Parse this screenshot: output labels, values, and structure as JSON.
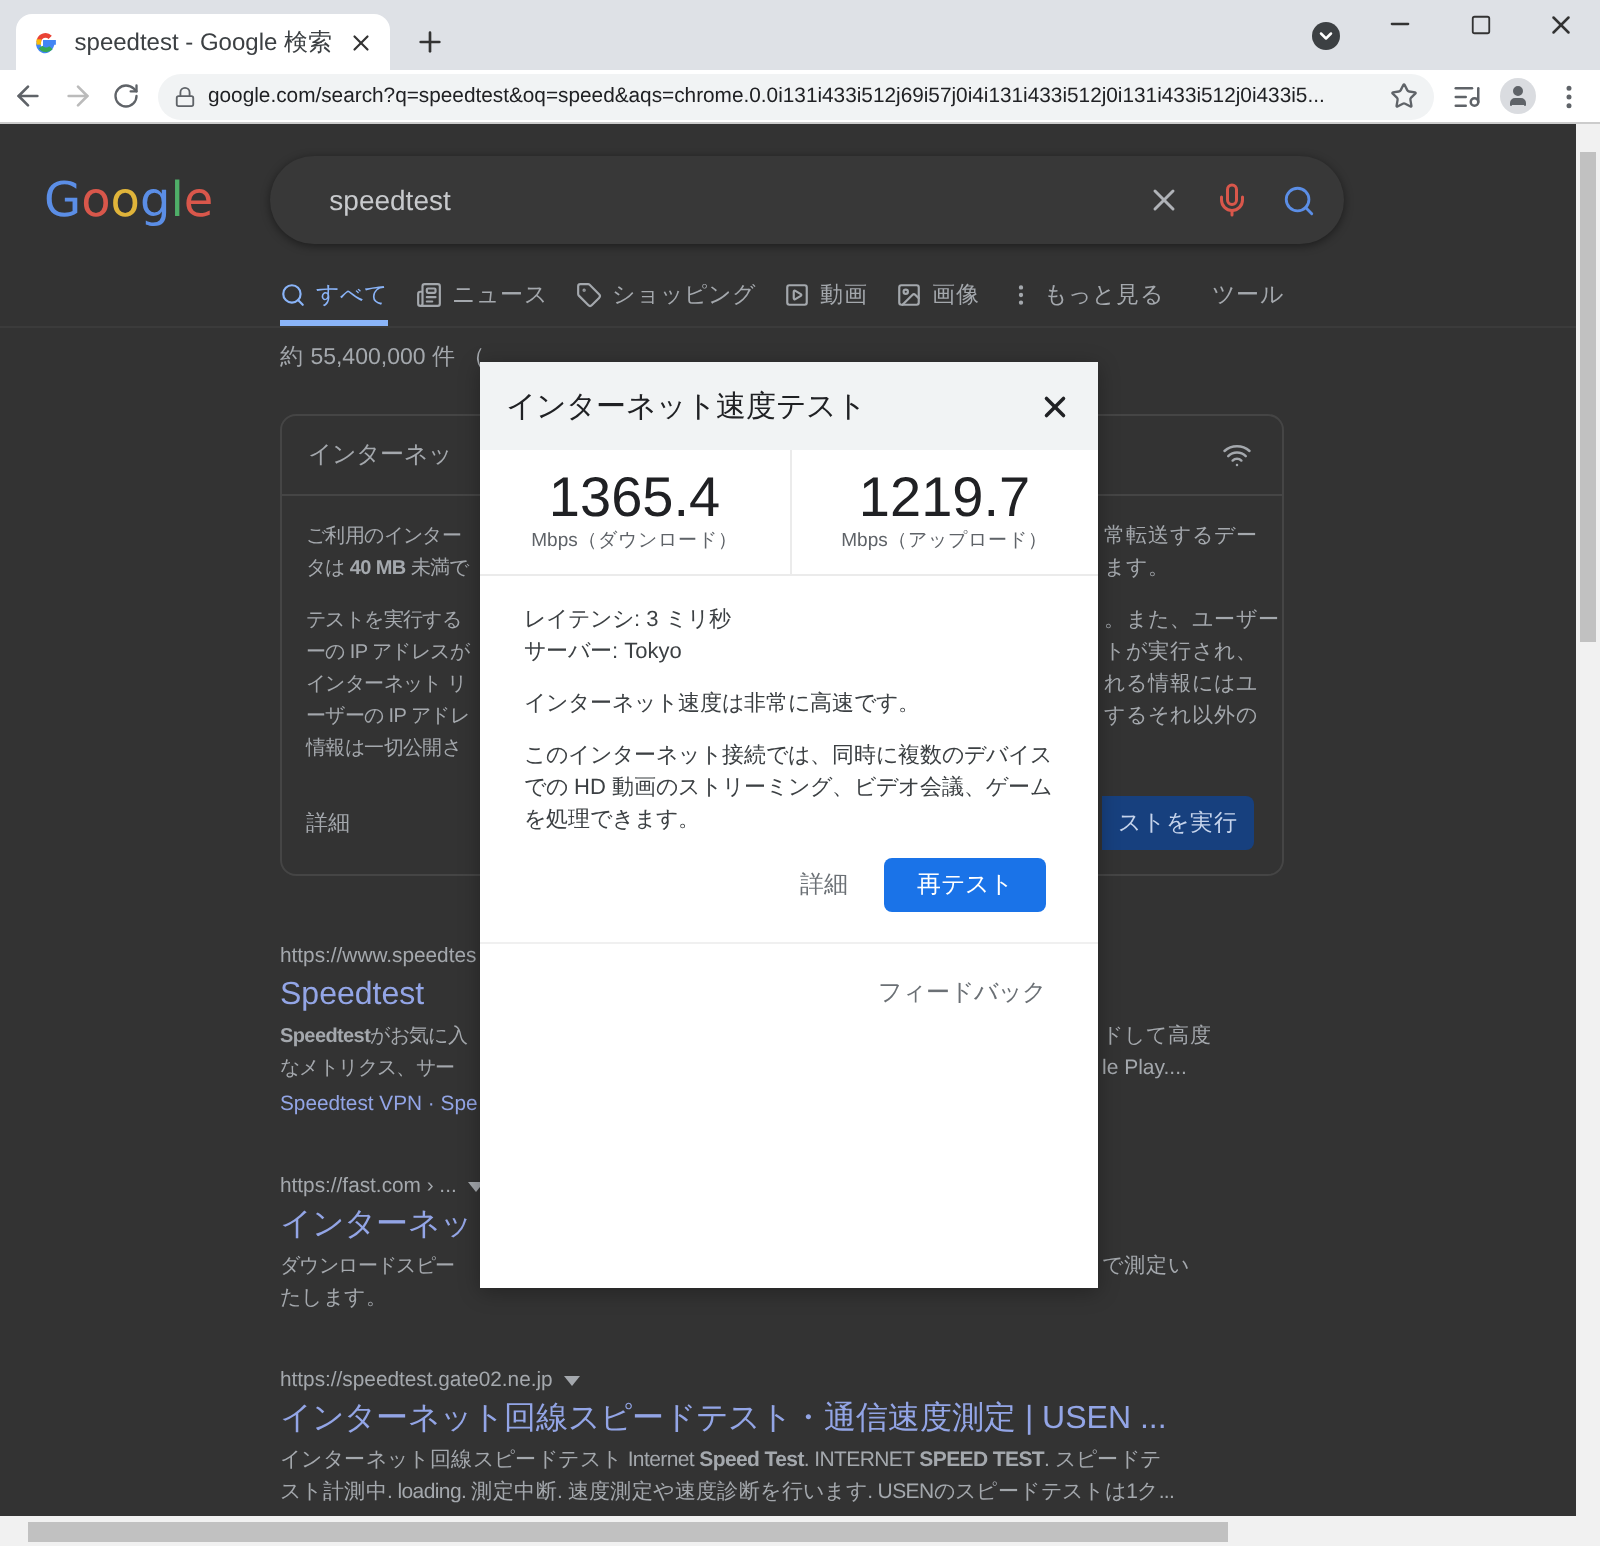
{
  "browser": {
    "tab_title": "speedtest - Google 検索",
    "address": "google.com/search?q=speedtest&oq=speed&aqs=chrome.0.0i131i433i512j69i57j0i4i131i433i512j0i131i433i512j0i433i5...",
    "forward_disabled": true
  },
  "logo": "Google",
  "search": {
    "query": "speedtest"
  },
  "nav_tabs": [
    {
      "label": "すべて",
      "kind": "search",
      "selected": true
    },
    {
      "label": "ニュース",
      "kind": "news",
      "selected": false
    },
    {
      "label": "ショッピング",
      "kind": "shopping",
      "selected": false
    },
    {
      "label": "動画",
      "kind": "video",
      "selected": false
    },
    {
      "label": "画像",
      "kind": "image",
      "selected": false
    },
    {
      "label": "もっと見る",
      "kind": "more",
      "selected": false
    },
    {
      "label": "ツール",
      "kind": "tools",
      "selected": false
    }
  ],
  "result_stats": "約 55,400,000 件 （",
  "card": {
    "title": "インターネッ",
    "paragraphs": [
      [
        {
          "left": "ご利用のインター",
          "right": "常転送するデー"
        },
        {
          "left": "タは **40 MB** 未満で",
          "right": "ます。"
        }
      ],
      [
        {
          "left": "テストを実行する",
          "right": "。また、ユーザー"
        },
        {
          "left": "ーの IP アドレスが",
          "right": "トが実行され、"
        },
        {
          "left": "インターネット リ",
          "right": "れる情報にはユ"
        },
        {
          "left": "ーザーの IP アドレ",
          "right": "するそれ以外の"
        },
        {
          "left": "情報は一切公開さ"
        }
      ]
    ],
    "details": "詳細",
    "run_button": "ストを実行"
  },
  "results": [
    {
      "url": "https://www.speedtes",
      "title": "Speedtest",
      "snippet": [
        {
          "left": "**Speedtest**がお気に入",
          "right": "ドして高度"
        },
        {
          "left": "なメトリクス、サー",
          "right": "le Play...."
        }
      ],
      "sitelinks": "Speedtest VPN · Spe"
    },
    {
      "url": "https://fast.com › ...",
      "url_menu": true,
      "title": "インターネッ",
      "snippet": [
        {
          "left": "ダウンロードスピー",
          "right": "で測定い"
        },
        {
          "left": "たします。"
        }
      ]
    },
    {
      "url": "https://speedtest.gate02.ne.jp",
      "url_menu": true,
      "title": "インターネット回線スピードテスト・通信速度測定 | USEN ...",
      "snippet": [
        {
          "left": "インターネット回線スピードテスト Internet **Speed Test**. INTERNET **SPEED TEST**. スピードテ"
        },
        {
          "left": "スト計測中. loading. 測定中断. 速度測定や速度診断を行います. USENのスピードテストは1ク..."
        }
      ]
    }
  ],
  "dialog": {
    "title": "インターネット速度テスト",
    "results": [
      {
        "value": "1365.4",
        "label": "Mbps（ダウンロード）"
      },
      {
        "value": "1219.7",
        "label": "Mbps（アップロード）"
      }
    ],
    "latency": "レイテンシ: 3 ミリ秒",
    "server": "サーバー: Tokyo",
    "verdict": "インターネット速度は非常に高速です。",
    "description": "このインターネット接続では、同時に複数のデバイスでの HD 動画のストリーミング、ビデオ会議、ゲームを処理できます。",
    "details_link": "詳細",
    "retest_button": "再テスト",
    "feedback_link": "フィードバック"
  }
}
